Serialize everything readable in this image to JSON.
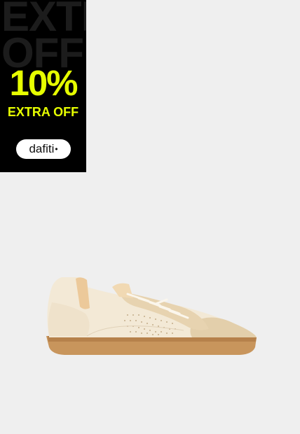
{
  "promo": {
    "background_word_1": "EXTRA",
    "background_word_2": "OFF",
    "percent": "10%",
    "label": "EXTRA OFF",
    "brand": "dafiti",
    "brand_mark": "•",
    "accent_color": "#e6ff00",
    "banner_color": "#000000"
  },
  "product": {
    "image": "sneaker",
    "background_color": "#efefef"
  }
}
